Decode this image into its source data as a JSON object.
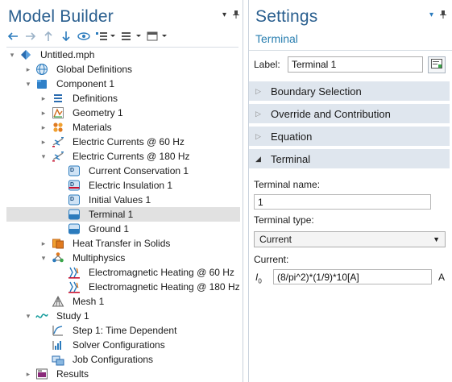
{
  "model_builder": {
    "title": "Model Builder",
    "tree": [
      {
        "label": "Untitled.mph",
        "icon": "model-file-icon",
        "toggle": "▾",
        "level": 0
      },
      {
        "label": "Global Definitions",
        "icon": "globe-icon",
        "toggle": "▸",
        "level": 1
      },
      {
        "label": "Component 1",
        "icon": "component-icon",
        "toggle": "▾",
        "level": 1
      },
      {
        "label": "Definitions",
        "icon": "definitions-icon",
        "toggle": "▸",
        "level": 2
      },
      {
        "label": "Geometry 1",
        "icon": "geometry-icon",
        "toggle": "▸",
        "level": 2
      },
      {
        "label": "Materials",
        "icon": "materials-icon",
        "toggle": "▸",
        "level": 2
      },
      {
        "label": "Electric Currents @ 60 Hz",
        "icon": "electric-currents-icon",
        "toggle": "▸",
        "level": 2
      },
      {
        "label": "Electric Currents @ 180 Hz",
        "icon": "electric-currents-icon",
        "toggle": "▾",
        "level": 2
      },
      {
        "label": "Current Conservation 1",
        "icon": "domain-feature-icon",
        "toggle": "",
        "level": 3
      },
      {
        "label": "Electric Insulation 1",
        "icon": "boundary-feature-icon",
        "toggle": "",
        "level": 3
      },
      {
        "label": "Initial Values 1",
        "icon": "domain-feature-icon",
        "toggle": "",
        "level": 3
      },
      {
        "label": "Terminal 1",
        "icon": "terminal-icon",
        "toggle": "",
        "level": 3,
        "selected": true
      },
      {
        "label": "Ground 1",
        "icon": "ground-icon",
        "toggle": "",
        "level": 3
      },
      {
        "label": "Heat Transfer in Solids",
        "icon": "heat-transfer-icon",
        "toggle": "▸",
        "level": 2
      },
      {
        "label": "Multiphysics",
        "icon": "multiphysics-icon",
        "toggle": "▾",
        "level": 2
      },
      {
        "label": "Electromagnetic Heating @ 60 Hz",
        "icon": "em-heating-icon",
        "toggle": "",
        "level": 3
      },
      {
        "label": "Electromagnetic Heating @ 180 Hz",
        "icon": "em-heating-icon",
        "toggle": "",
        "level": 3
      },
      {
        "label": "Mesh 1",
        "icon": "mesh-icon",
        "toggle": "",
        "level": 2
      },
      {
        "label": "Study 1",
        "icon": "study-icon",
        "toggle": "▾",
        "level": 1
      },
      {
        "label": "Step 1: Time Dependent",
        "icon": "time-dependent-icon",
        "toggle": "",
        "level": 2
      },
      {
        "label": "Solver Configurations",
        "icon": "solver-icon",
        "toggle": "",
        "level": 2
      },
      {
        "label": "Job Configurations",
        "icon": "job-icon",
        "toggle": "",
        "level": 2
      },
      {
        "label": "Results",
        "icon": "results-icon",
        "toggle": "▸",
        "level": 1
      }
    ]
  },
  "settings": {
    "title": "Settings",
    "subtitle": "Terminal",
    "label_caption": "Label:",
    "label_value": "Terminal 1",
    "sections": [
      {
        "label": "Boundary Selection",
        "toggle": "▷"
      },
      {
        "label": "Override and Contribution",
        "toggle": "▷"
      },
      {
        "label": "Equation",
        "toggle": "▷"
      },
      {
        "label": "Terminal",
        "toggle": "◢"
      }
    ],
    "terminal_name_label": "Terminal name:",
    "terminal_name_value": "1",
    "terminal_type_label": "Terminal type:",
    "terminal_type_value": "Current",
    "current_label": "Current:",
    "current_symbol": "I",
    "current_symbol_sub": "0",
    "current_value": "(8/pi^2)*(1/9)*10[A]",
    "current_unit": "A"
  },
  "colors": {
    "title": "#2a5f8f",
    "section_bg": "#dfe6ee",
    "selection": "#e1e1e1"
  }
}
